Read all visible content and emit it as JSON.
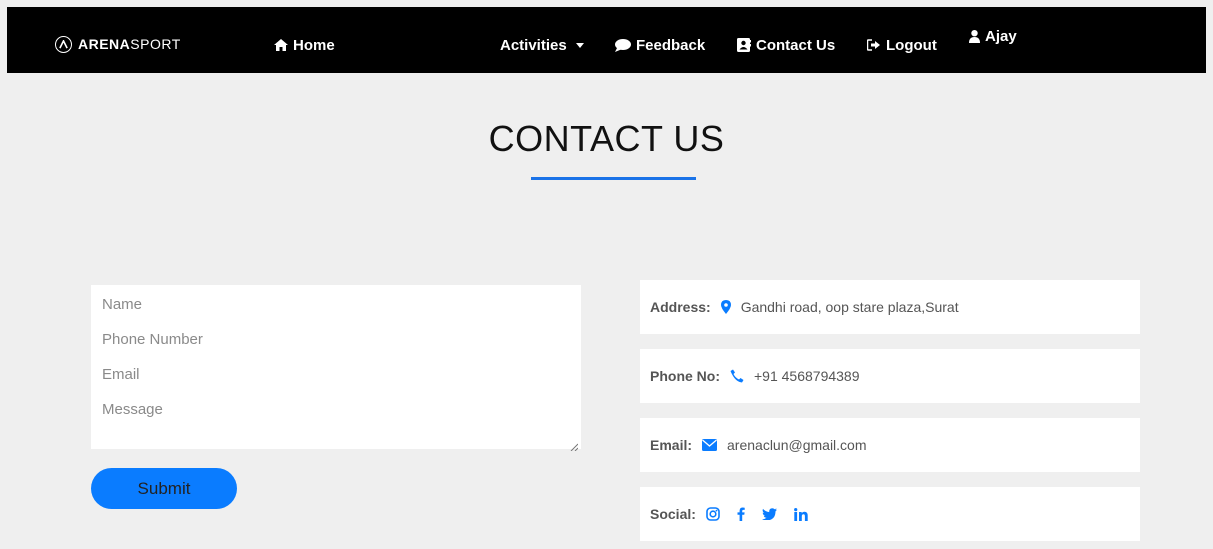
{
  "brand": {
    "name_bold": "ARENA",
    "name_light": "SPORT"
  },
  "nav": {
    "home": "Home",
    "activities": "Activities",
    "feedback": "Feedback",
    "contact": "Contact Us",
    "logout": "Logout",
    "user": "Ajay"
  },
  "page": {
    "title": "CONTACT US"
  },
  "form": {
    "name_placeholder": "Name",
    "phone_placeholder": "Phone Number",
    "email_placeholder": "Email",
    "message_placeholder": "Message",
    "submit_label": "Submit"
  },
  "contact": {
    "address_label": "Address:",
    "address_value": "Gandhi road, oop stare plaza,Surat",
    "phone_label": "Phone No:",
    "phone_value": "+91 4568794389",
    "email_label": "Email:",
    "email_value": "arenaclun@gmail.com",
    "social_label": "Social:"
  },
  "icons": {
    "home": "home-icon",
    "feedback": "comment-icon",
    "contact": "address-card-icon",
    "logout": "sign-out-icon",
    "user": "user-icon",
    "address": "map-marker-icon",
    "phone": "phone-icon",
    "email": "envelope-icon",
    "social": [
      "instagram-icon",
      "facebook-icon",
      "twitter-icon",
      "linkedin-icon"
    ]
  },
  "colors": {
    "accent": "#0a7cff",
    "navbar": "#000000",
    "background": "#efefef",
    "underline": "#1a73e8"
  }
}
